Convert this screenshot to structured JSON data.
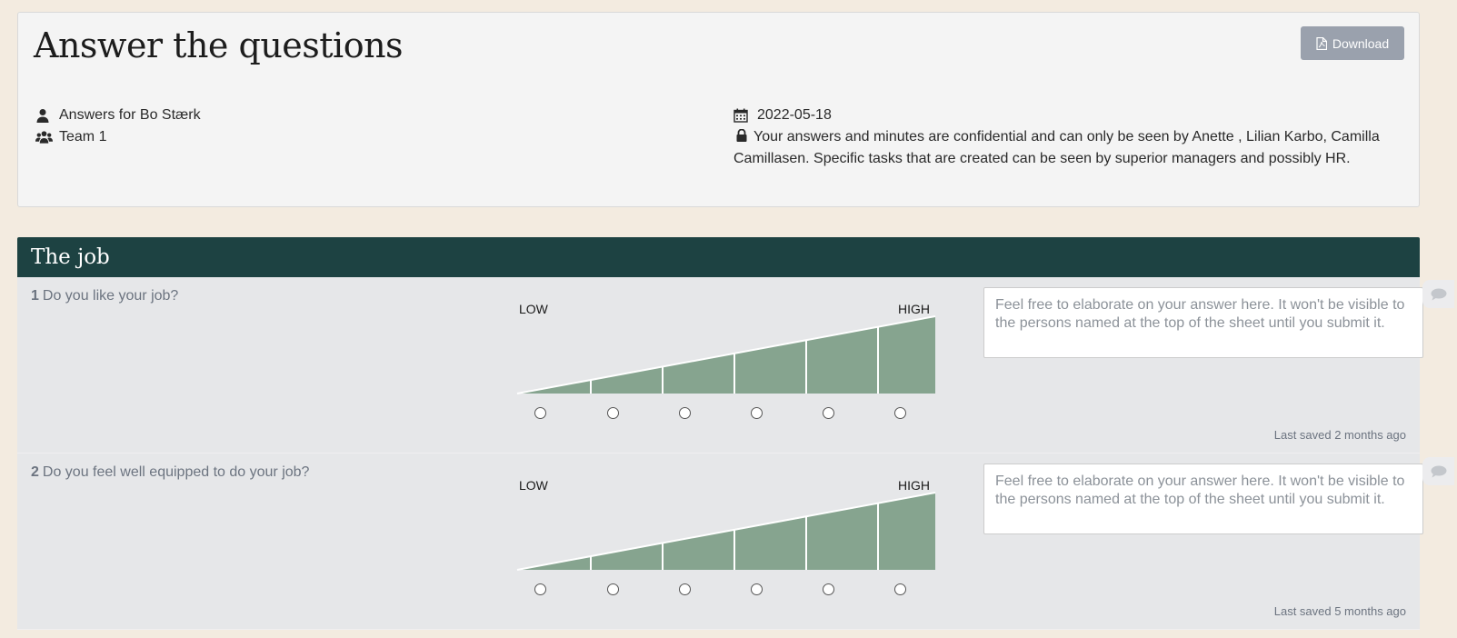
{
  "header": {
    "title": "Answer the questions",
    "download_label": "Download",
    "answers_for": "Answers for Bo Stærk",
    "team": "Team 1",
    "date": "2022-05-18",
    "confidential_text": "Your answers and minutes are confidential and can only be seen by Anette , Lilian Karbo, Camilla Camillasen. Specific tasks that are created can be seen by superior managers and possibly HR."
  },
  "section": {
    "title": "The job"
  },
  "scale": {
    "low_label": "LOW",
    "high_label": "HIGH",
    "ramp_color": "#86a48f"
  },
  "questions": [
    {
      "number": "1",
      "text": "Do you like your job?",
      "comment_placeholder": "Feel free to elaborate on your answer here. It won't be visible to the persons named at the top of the sheet until you submit it.",
      "last_saved": "Last saved 2 months ago"
    },
    {
      "number": "2",
      "text": "Do you feel well equipped to do your job?",
      "comment_placeholder": "Feel free to elaborate on your answer here. It won't be visible to the persons named at the top of the sheet until you submit it.",
      "last_saved": "Last saved 5 months ago"
    }
  ],
  "icons": {
    "download": "file-pdf-icon",
    "user": "user-icon",
    "team": "users-icon",
    "date": "calendar-icon",
    "lock": "lock-icon",
    "comment": "comment-bubble-icon"
  },
  "colors": {
    "page_bg": "#f3ebe0",
    "section_header": "#1d4242",
    "download_button": "#9aa1ad"
  }
}
